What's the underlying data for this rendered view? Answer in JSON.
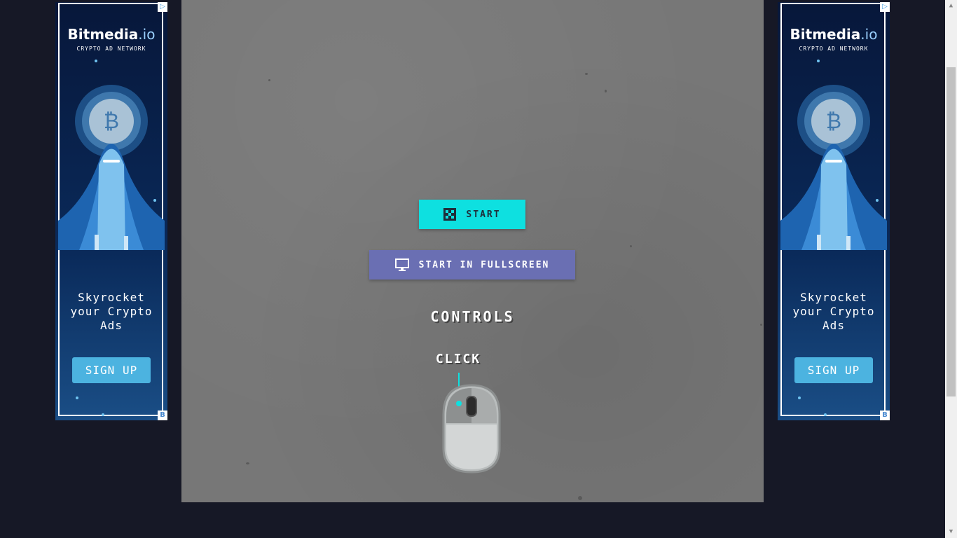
{
  "game": {
    "start_label": "START",
    "fullscreen_label": "START IN FULLSCREEN",
    "controls_title": "CONTROLS",
    "click_label": "CLICK",
    "accent_start": "#0ee0e0",
    "accent_fullscreen": "#6a6fb3"
  },
  "ads": {
    "left": {
      "brand": "Bitmedia",
      "brand_suffix": ".io",
      "subtitle": "CRYPTO AD NETWORK",
      "tagline": "Skyrocket your Crypto Ads",
      "cta": "SIGN UP",
      "info_icon": "▷",
      "badge": "B"
    },
    "right": {
      "brand": "Bitmedia",
      "brand_suffix": ".io",
      "subtitle": "CRYPTO AD NETWORK",
      "tagline": "Skyrocket your Crypto Ads",
      "cta": "SIGN UP",
      "info_icon": "▷",
      "badge": "B"
    }
  },
  "scrollbar": {
    "up": "▲",
    "down": "▼"
  }
}
